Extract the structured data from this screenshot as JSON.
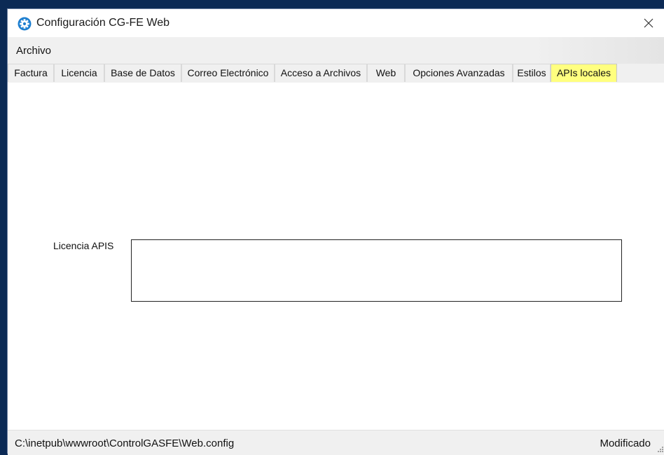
{
  "window": {
    "title": "Configuración CG-FE Web",
    "app_icon": "gear-icon",
    "close_icon": "close-icon"
  },
  "menu": {
    "items": [
      "Archivo"
    ]
  },
  "tabs": [
    "Factura",
    "Licencia",
    "Base de Datos",
    "Correo Electrónico",
    "Acceso a Archivos",
    "Web",
    "Opciones Avanzadas",
    "Estilos",
    "APIs locales"
  ],
  "active_tab": "APIs locales",
  "form": {
    "licencia_label": "Licencia APIS",
    "licencia_value": ""
  },
  "status": {
    "path": "C:\\inetpub\\wwwroot\\ControlGASFE\\Web.config",
    "state": "Modificado"
  },
  "colors": {
    "active_tab": "#ffff7f",
    "app_icon": "#1e7fd0",
    "background": "#0b2a55"
  }
}
